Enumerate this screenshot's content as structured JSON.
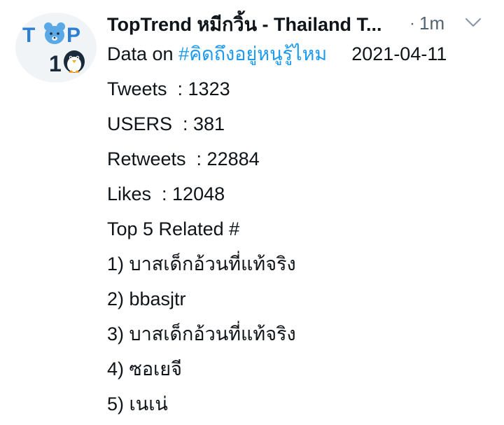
{
  "tweet": {
    "author_name": "TopTrend หมีกวิ้น - Thailand T...",
    "separator": "·",
    "time": "1m",
    "avatar_text_top": "T",
    "avatar_text_o": "O",
    "avatar_text_p": "P",
    "avatar_text_1": "1",
    "avatar_text_0": "0",
    "body": {
      "data_on_label": "Data on",
      "hashtag": "#คิดถึงอยู่หนูรู้ไหม",
      "date": "2021-04-11",
      "tweets": "Tweets  : 1323",
      "users": "USERS  : 381",
      "retweets": "Retweets  : 22884",
      "likes": "Likes  : 12048",
      "related_heading": "Top 5 Related #",
      "related": [
        "1) บาสเด็กอ้วนที่แท้จริง",
        "2) bbasjtr",
        "3) บาสเด็กอ้วนที่แท้จริง",
        "4) ซอเยจี",
        "5) เนเน่"
      ]
    },
    "colors": {
      "hashtag": "#1d9bf0",
      "muted": "#536471",
      "text": "#0f1419",
      "logo_blue": "#2d7fd3",
      "logo_dark": "#1a2a3a"
    }
  }
}
